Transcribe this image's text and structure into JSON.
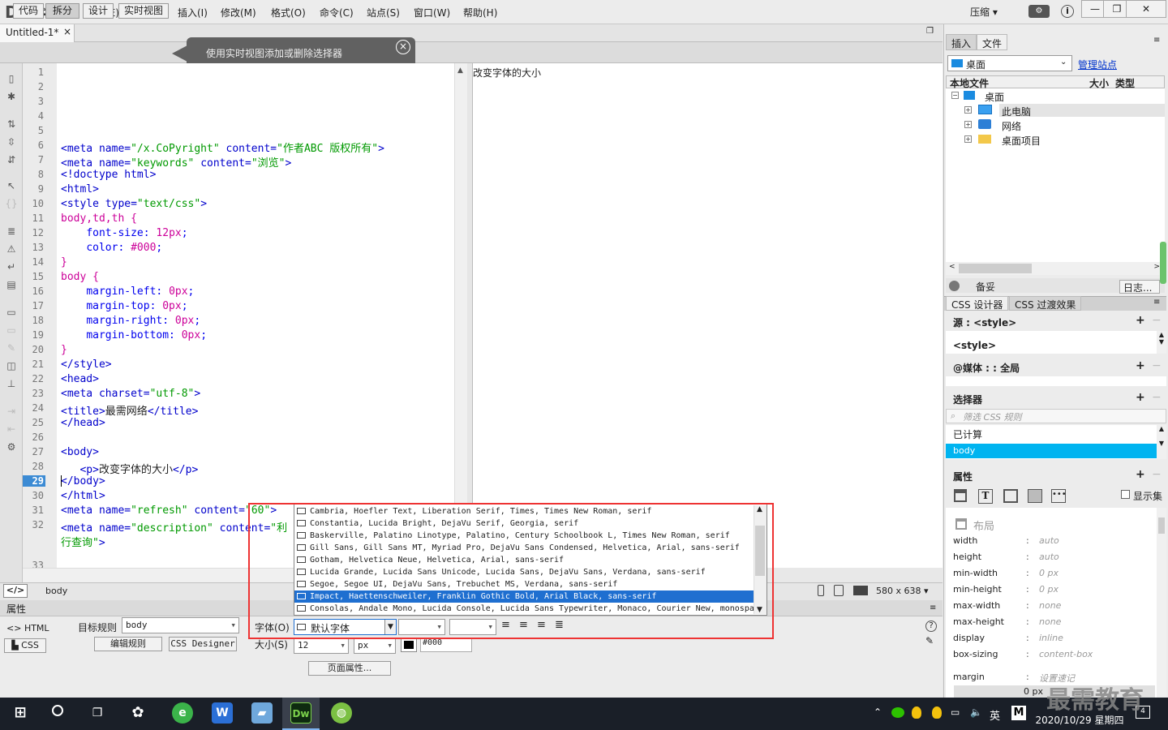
{
  "app": {
    "logo": "Dw",
    "compress": "压缩"
  },
  "menu": [
    "文件(F)",
    "编辑(E)",
    "查看(V)",
    "插入(I)",
    "修改(M)",
    "格式(O)",
    "命令(C)",
    "站点(S)",
    "窗口(W)",
    "帮助(H)"
  ],
  "window": {
    "minimize": "—",
    "maximize": "❐",
    "close": "✕"
  },
  "document": {
    "tab": "Untitled-1*",
    "tab_close": "×"
  },
  "view_buttons": [
    "代码",
    "拆分",
    "设计",
    "实时视图"
  ],
  "tooltip": "使用实时视图添加或删除选择器",
  "code_lines": [
    {
      "n": "1",
      "html": ""
    },
    {
      "n": "2",
      "html": ""
    },
    {
      "n": "3",
      "html": ""
    },
    {
      "n": "4",
      "html": ""
    },
    {
      "n": "5",
      "html": ""
    },
    {
      "n": "6",
      "html": "<span class='tag'>&lt;meta name=</span><span class='str'>\"/x.CoPyright\"</span><span class='tag'> content=</span><span class='str'>\"作者ABC 版权所有\"</span><span class='tag'>&gt;</span>"
    },
    {
      "n": "7",
      "html": "<span class='tag'>&lt;meta name=</span><span class='str'>\"keywords\"</span><span class='tag'> content=</span><span class='str'>\"浏览\"</span><span class='tag'>&gt;</span>"
    },
    {
      "n": "8",
      "html": "<span class='tag'>&lt;!doctype html&gt;</span>"
    },
    {
      "n": "9",
      "html": "<span class='tag'>&lt;html&gt;</span>"
    },
    {
      "n": "10",
      "html": "<span class='tag'>&lt;style type=</span><span class='str'>\"text/css\"</span><span class='tag'>&gt;</span>"
    },
    {
      "n": "11",
      "html": "<span class='sel'>body,td,th {</span>"
    },
    {
      "n": "12",
      "html": "    <span class='prop'>font-size:</span> <span class='val'>12px</span><span class='prop'>;</span>"
    },
    {
      "n": "13",
      "html": "    <span class='prop'>color:</span> <span class='val'>#000</span><span class='prop'>;</span>"
    },
    {
      "n": "14",
      "html": "<span class='sel'>}</span>"
    },
    {
      "n": "15",
      "html": "<span class='sel'>body {</span>"
    },
    {
      "n": "16",
      "html": "    <span class='prop'>margin-left:</span> <span class='val'>0px</span><span class='prop'>;</span>"
    },
    {
      "n": "17",
      "html": "    <span class='prop'>margin-top:</span> <span class='val'>0px</span><span class='prop'>;</span>"
    },
    {
      "n": "18",
      "html": "    <span class='prop'>margin-right:</span> <span class='val'>0px</span><span class='prop'>;</span>"
    },
    {
      "n": "19",
      "html": "    <span class='prop'>margin-bottom:</span> <span class='val'>0px</span><span class='prop'>;</span>"
    },
    {
      "n": "20",
      "html": "<span class='sel'>}</span>"
    },
    {
      "n": "21",
      "html": "<span class='tag'>&lt;/style&gt;</span>"
    },
    {
      "n": "22",
      "html": "<span class='tag'>&lt;head&gt;</span>"
    },
    {
      "n": "23",
      "html": "<span class='tag'>&lt;meta charset=</span><span class='str'>\"utf-8\"</span><span class='tag'>&gt;</span>"
    },
    {
      "n": "24",
      "html": "<span class='tag'>&lt;title&gt;</span><span class='txt'>最需网络</span><span class='tag'>&lt;/title&gt;</span>"
    },
    {
      "n": "25",
      "html": "<span class='tag'>&lt;/head&gt;</span>"
    },
    {
      "n": "26",
      "html": ""
    },
    {
      "n": "27",
      "html": "<span class='tag'>&lt;body&gt;</span>"
    },
    {
      "n": "28",
      "html": "   <span class='tag'>&lt;p&gt;</span><span class='txt'>改变字体的大小</span><span class='tag'>&lt;/p&gt;</span>"
    },
    {
      "n": "29",
      "html": "<span class='tag'>&lt;/body&gt;</span>"
    },
    {
      "n": "30",
      "html": "<span class='tag'>&lt;/html&gt;</span>"
    },
    {
      "n": "31",
      "html": "<span class='tag'>&lt;meta name=</span><span class='str'>\"refresh\"</span><span class='tag'> content=</span><span class='str'>\"60\"</span><span class='tag'>&gt;</span>"
    },
    {
      "n": "32",
      "html": "<span class='tag'>&lt;meta name=</span><span class='str'>\"description\"</span><span class='tag'> content=</span><span class='str'>\"利</span>"
    },
    {
      "n": "",
      "html": "<span class='str'>行查询\"</span><span class='tag'>&gt;</span>"
    },
    {
      "n": "33",
      "html": ""
    }
  ],
  "active_line": "29",
  "design_text": "改变字体的大小",
  "status": {
    "tag": "body",
    "size": "580 x 638 ▾"
  },
  "props": {
    "title": "属性",
    "html": "HTML",
    "css": "CSS",
    "target_rule_label": "目标规则",
    "target_rule": "body",
    "edit_rule": "编辑规则",
    "css_designer": "CSS Designer",
    "font_label": "字体(O)",
    "size_label": "大小(S)",
    "font_value": "默认字体",
    "size_value": "12",
    "unit": "px",
    "color_value": "#000",
    "page_props": "页面属性..."
  },
  "font_options": [
    "Cambria, Hoefler Text, Liberation Serif, Times, Times New Roman, serif",
    "Constantia, Lucida Bright, DejaVu Serif, Georgia, serif",
    "Baskerville, Palatino Linotype, Palatino, Century Schoolbook L, Times New Roman, serif",
    "Gill Sans, Gill Sans MT, Myriad Pro, DejaVu Sans Condensed, Helvetica, Arial, sans-serif",
    "Gotham, Helvetica Neue, Helvetica, Arial, sans-serif",
    "Lucida Grande, Lucida Sans Unicode, Lucida Sans, DejaVu Sans, Verdana, sans-serif",
    "Segoe, Segoe UI, DejaVu Sans, Trebuchet MS, Verdana, sans-serif",
    "Impact, Haettenschweiler, Franklin Gothic Bold, Arial Black, sans-serif",
    "Consolas, Andale Mono, Lucida Console, Lucida Sans Typewriter, Monaco, Courier New, monospa"
  ],
  "highlighted_option": 7,
  "files_panel": {
    "tab_insert": "插入",
    "tab_files": "文件",
    "location": "桌面",
    "manage": "管理站点",
    "col_local": "本地文件",
    "col_size": "大小",
    "col_type": "类型",
    "tree": [
      "桌面",
      "此电脑",
      "网络",
      "桌面项目"
    ],
    "footer_left": "备妥",
    "footer_right": "日志..."
  },
  "css_panel": {
    "tab_designer": "CSS 设计器",
    "tab_transition": "CSS 过渡效果",
    "source_label": "源 : <style>",
    "source_item": "<style>",
    "media_label": "@媒体 : : 全局",
    "selectors_label": "选择器",
    "filter_placeholder": "筛选 CSS 规则",
    "computed": "已计算",
    "selected": "body",
    "props_label": "属性",
    "show_set": "显示集",
    "layout": "布局",
    "properties": [
      {
        "name": "width",
        "value": "auto"
      },
      {
        "name": "height",
        "value": "auto"
      },
      {
        "name": "min-width",
        "value": "0 px"
      },
      {
        "name": "min-height",
        "value": "0 px"
      },
      {
        "name": "max-width",
        "value": "none"
      },
      {
        "name": "max-height",
        "value": "none"
      },
      {
        "name": "display",
        "value": "inline"
      },
      {
        "name": "box-sizing",
        "value": "content-box"
      },
      {
        "name": "margin",
        "value": "设置速记"
      }
    ],
    "margin_value": "0 px"
  },
  "taskbar": {
    "ime": "英",
    "time": "2020/10/29 星期四",
    "badge": "4"
  },
  "watermark": "最需教育",
  "colors": {
    "accent": "#1f6fd0",
    "highlight_red": "#e33333",
    "selected_cyan": "#00b4f0"
  }
}
